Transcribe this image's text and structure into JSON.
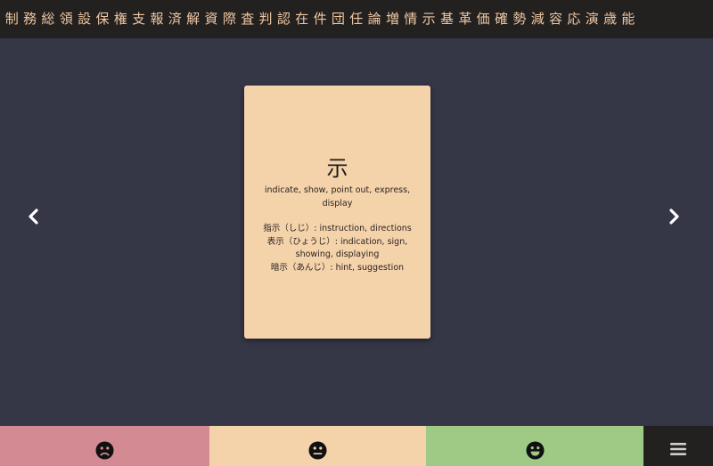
{
  "kanji_list": [
    "制",
    "務",
    "総",
    "領",
    "設",
    "保",
    "権",
    "支",
    "報",
    "済",
    "解",
    "資",
    "際",
    "査",
    "判",
    "認",
    "在",
    "件",
    "団",
    "任",
    "論",
    "増",
    "情",
    "示",
    "基",
    "革",
    "価",
    "確",
    "勢",
    "減",
    "容",
    "応",
    "演",
    "歳",
    "能"
  ],
  "card": {
    "kanji": "示",
    "meaning": "indicate, show, point out, express, display",
    "examples": [
      "指示（しじ）: instruction, directions",
      "表示（ひょうじ）: indication, sign, showing, displaying",
      "暗示（あんじ）: hint, suggestion"
    ]
  },
  "icons": {
    "prev": "chevron-left-icon",
    "next": "chevron-right-icon",
    "hard": "frown-face-icon",
    "okay": "neutral-face-icon",
    "easy": "smile-face-icon",
    "menu": "hamburger-menu-icon"
  },
  "colors": {
    "background": "#353646",
    "topbar": "#232020",
    "kanji_text": "#efc8a2",
    "card": "#f4d3ab",
    "hard": "#d48a93",
    "okay": "#f4d3ab",
    "easy": "#9fca86",
    "menu": "#232020"
  }
}
